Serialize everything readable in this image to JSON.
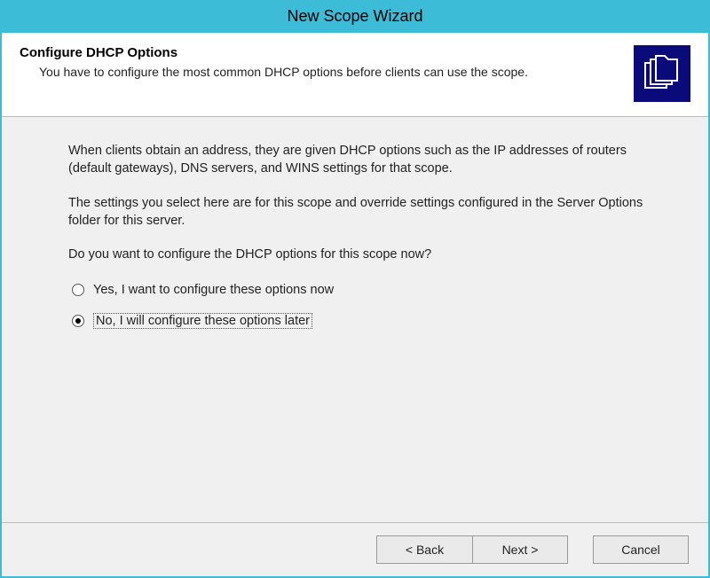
{
  "window": {
    "title": "New Scope Wizard"
  },
  "header": {
    "title": "Configure DHCP Options",
    "subtitle": "You have to configure the most common DHCP options before clients can use the scope."
  },
  "content": {
    "para1": "When clients obtain an address, they are given DHCP options such as the IP addresses of routers (default gateways), DNS servers, and WINS settings for that scope.",
    "para2": "The settings you select here are for this scope and override settings configured in the Server Options folder for this server.",
    "question": "Do you want to configure the DHCP options for this scope now?",
    "option_yes": "Yes, I want to configure these options now",
    "option_no": "No, I will configure these options later",
    "selected": "no"
  },
  "buttons": {
    "back": "< Back",
    "next": "Next >",
    "cancel": "Cancel"
  }
}
